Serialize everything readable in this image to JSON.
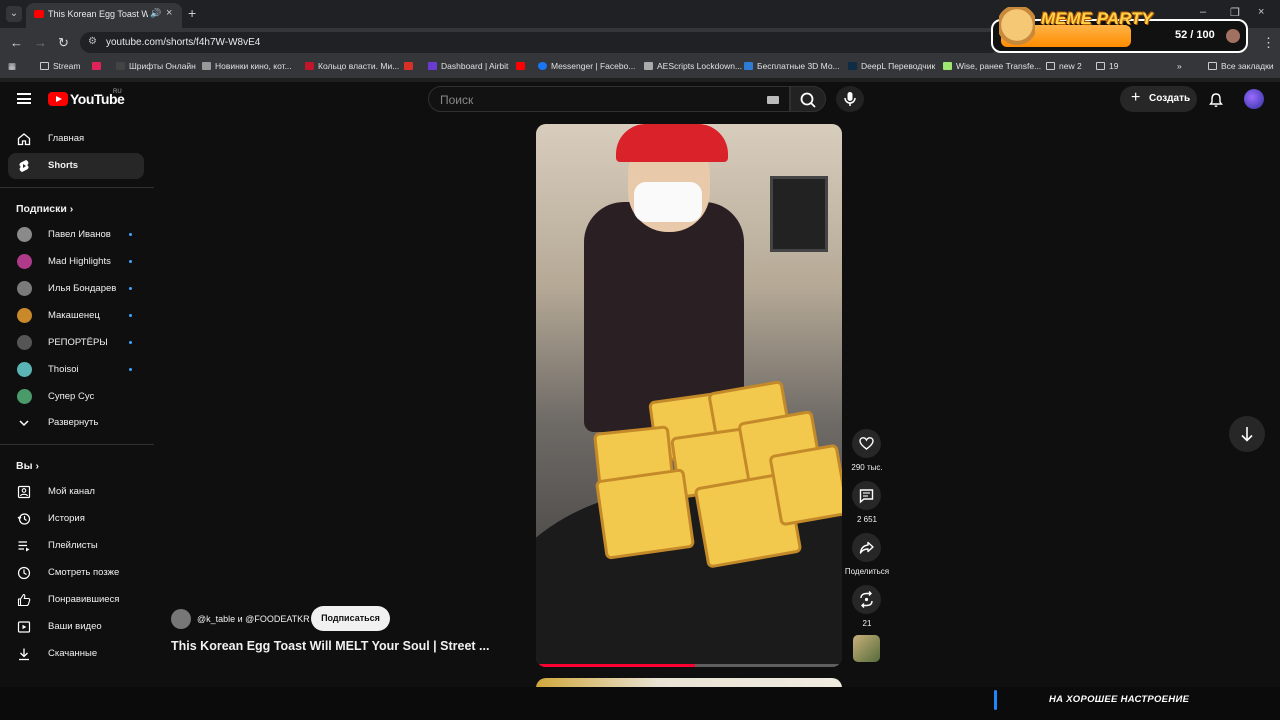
{
  "browser": {
    "tab_title": "This Korean Egg Toast Will",
    "url": "youtube.com/shorts/f4h7W-W8vE4",
    "bookmarks": [
      "Stream",
      "Шрифты Онлайн",
      "Новинки кино, кот...",
      "Кольцо власти. Ми...",
      "Dashboard | Airbit",
      "Messenger | Facebo...",
      "AEScripts Lockdown...",
      "Бесплатные 3D Мо...",
      "DeepL Переводчик",
      "Wise, ранее Transfe...",
      "new 2",
      "19"
    ],
    "all_bookmarks": "Все закладки"
  },
  "meme_widget": {
    "brand": "MEME PARTY",
    "score": "52 / 100"
  },
  "header": {
    "logo_text": "YouTube",
    "region": "RU",
    "search_placeholder": "Поиск",
    "create_label": "Создать"
  },
  "sidebar": {
    "main": [
      {
        "label": "Главная",
        "icon": "home-icon"
      },
      {
        "label": "Shorts",
        "icon": "shorts-icon",
        "active": true
      }
    ],
    "subscriptions_title": "Подписки",
    "subscriptions": [
      {
        "label": "Павел Иванов",
        "color": "#8a8a8a"
      },
      {
        "label": "Mad Highlights",
        "color": "#b03a8a"
      },
      {
        "label": "Илья Бондарев",
        "color": "#7a7a7a"
      },
      {
        "label": "Макашенец",
        "color": "#c9882a"
      },
      {
        "label": "РЕПОРТЁРЫ",
        "color": "#555555"
      },
      {
        "label": "Thoisoi",
        "color": "#5ab4b4"
      },
      {
        "label": "Супер Сус",
        "color": "#4a9a6a"
      }
    ],
    "expand_label": "Развернуть",
    "you_title": "Вы",
    "you_items": [
      {
        "label": "Мой канал",
        "icon": "channel-icon"
      },
      {
        "label": "История",
        "icon": "history-icon"
      },
      {
        "label": "Плейлисты",
        "icon": "playlists-icon"
      },
      {
        "label": "Смотреть позже",
        "icon": "watch-later-icon"
      },
      {
        "label": "Понравившиеся",
        "icon": "liked-icon"
      },
      {
        "label": "Ваши видео",
        "icon": "your-videos-icon"
      },
      {
        "label": "Скачанные",
        "icon": "downloads-icon"
      }
    ]
  },
  "short": {
    "channel": "@k_table и @FOODEATKR",
    "subscribe_label": "Подписаться",
    "title": "This Korean Egg Toast Will MELT Your Soul  | Street ...",
    "likes": "290 тыс.",
    "comments": "2 651",
    "share_label": "Поделиться",
    "remix_count": "21",
    "progress": 0.52
  },
  "overlay": {
    "mood_text": "НА ХОРОШЕЕ НАСТРОЕНИЕ"
  },
  "colors": {
    "accent": "#ff0000",
    "progress": "#ff0033",
    "link_dot": "#3ea6ff"
  }
}
